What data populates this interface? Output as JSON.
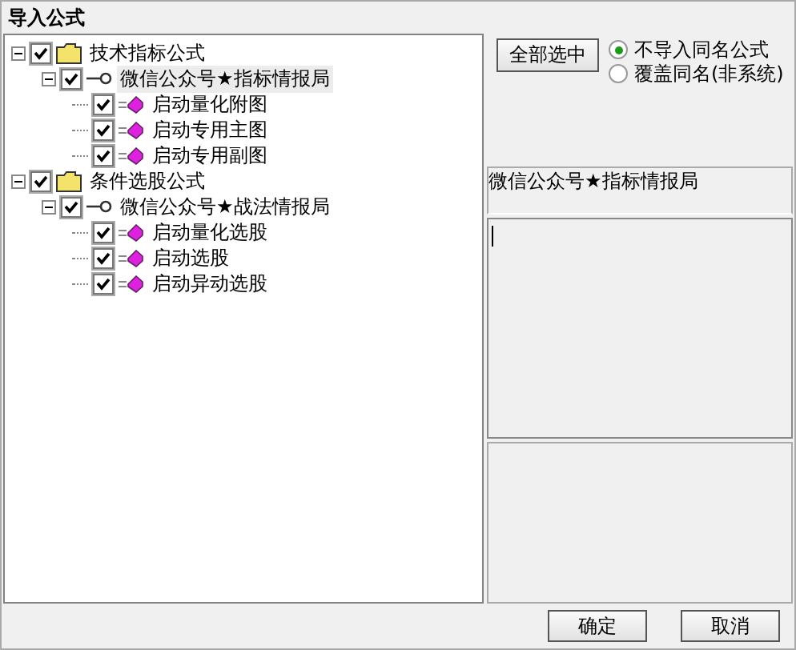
{
  "window": {
    "title": "导入公式"
  },
  "tree": [
    {
      "kind": "folder",
      "label": "技术指标公式",
      "checked": true,
      "expanded": true,
      "selected": false,
      "children": [
        {
          "kind": "key",
          "label": "微信公众号★指标情报局",
          "checked": true,
          "expanded": true,
          "selected": true,
          "children": [
            {
              "kind": "formula",
              "label": "启动量化附图",
              "checked": true,
              "selected": false
            },
            {
              "kind": "formula",
              "label": "启动专用主图",
              "checked": true,
              "selected": false
            },
            {
              "kind": "formula",
              "label": "启动专用副图",
              "checked": true,
              "selected": false
            }
          ]
        }
      ]
    },
    {
      "kind": "folder",
      "label": "条件选股公式",
      "checked": true,
      "expanded": true,
      "selected": false,
      "children": [
        {
          "kind": "key",
          "label": "微信公众号★战法情报局",
          "checked": true,
          "expanded": true,
          "selected": false,
          "children": [
            {
              "kind": "formula",
              "label": "启动量化选股",
              "checked": true,
              "selected": false
            },
            {
              "kind": "formula",
              "label": "启动选股",
              "checked": true,
              "selected": false
            },
            {
              "kind": "formula",
              "label": "启动异动选股",
              "checked": true,
              "selected": false
            }
          ]
        }
      ]
    }
  ],
  "select_all_button": "全部选中",
  "options": [
    {
      "label": "不导入同名公式",
      "selected": true
    },
    {
      "label": "覆盖同名(非系统)",
      "selected": false
    }
  ],
  "info_label": "微信公众号★指标情报局",
  "buttons": [
    "确定",
    "取消"
  ]
}
